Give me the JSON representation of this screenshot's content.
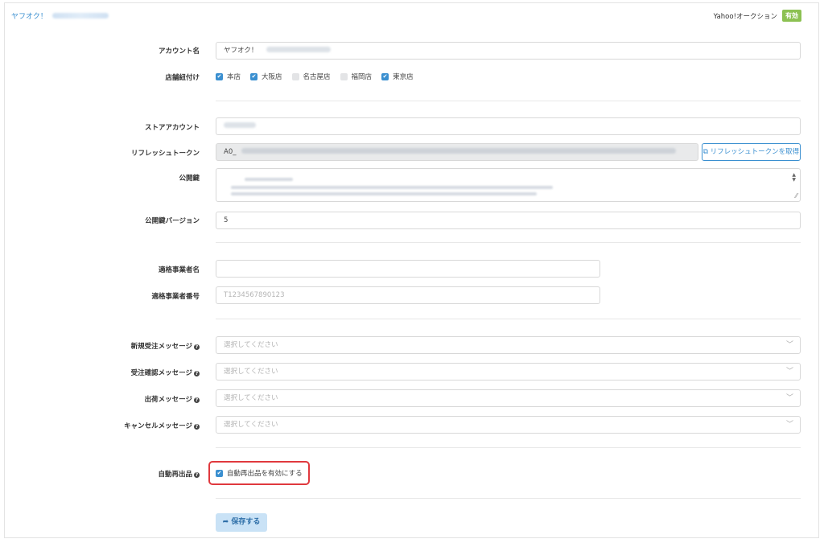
{
  "header": {
    "account_link": "ヤフオク！",
    "platform": "Yahoo!オークション",
    "status_badge": "有効"
  },
  "form": {
    "account_name": {
      "label": "アカウント名",
      "value": "ヤフオク！"
    },
    "store_links": {
      "label": "店舗紐付け",
      "options": [
        {
          "label": "本店",
          "checked": true
        },
        {
          "label": "大阪店",
          "checked": true
        },
        {
          "label": "名古屋店",
          "checked": false
        },
        {
          "label": "福岡店",
          "checked": false
        },
        {
          "label": "東京店",
          "checked": true
        }
      ]
    },
    "store_account": {
      "label": "ストアアカウント",
      "value": ""
    },
    "refresh_token": {
      "label": "リフレッシュトークン",
      "value": "A0_",
      "button": "リフレッシュトークンを取得"
    },
    "public_key": {
      "label": "公開鍵"
    },
    "public_key_version": {
      "label": "公開鍵バージョン",
      "value": "5"
    },
    "invoice_name": {
      "label": "適格事業者名",
      "value": ""
    },
    "invoice_number": {
      "label": "適格事業者番号",
      "placeholder": "T1234567890123"
    },
    "messages": [
      {
        "label": "新規受注メッセージ",
        "placeholder": "選択してください"
      },
      {
        "label": "受注確認メッセージ",
        "placeholder": "選択してください"
      },
      {
        "label": "出荷メッセージ",
        "placeholder": "選択してください"
      },
      {
        "label": "キャンセルメッセージ",
        "placeholder": "選択してください"
      }
    ],
    "auto_relist": {
      "label": "自動再出品",
      "checkbox_label": "自動再出品を有効にする",
      "checked": true
    },
    "save_label": "保存する"
  },
  "colors": {
    "accent": "#3a8fd0",
    "badge": "#8cc152",
    "highlight": "#e0393e"
  }
}
